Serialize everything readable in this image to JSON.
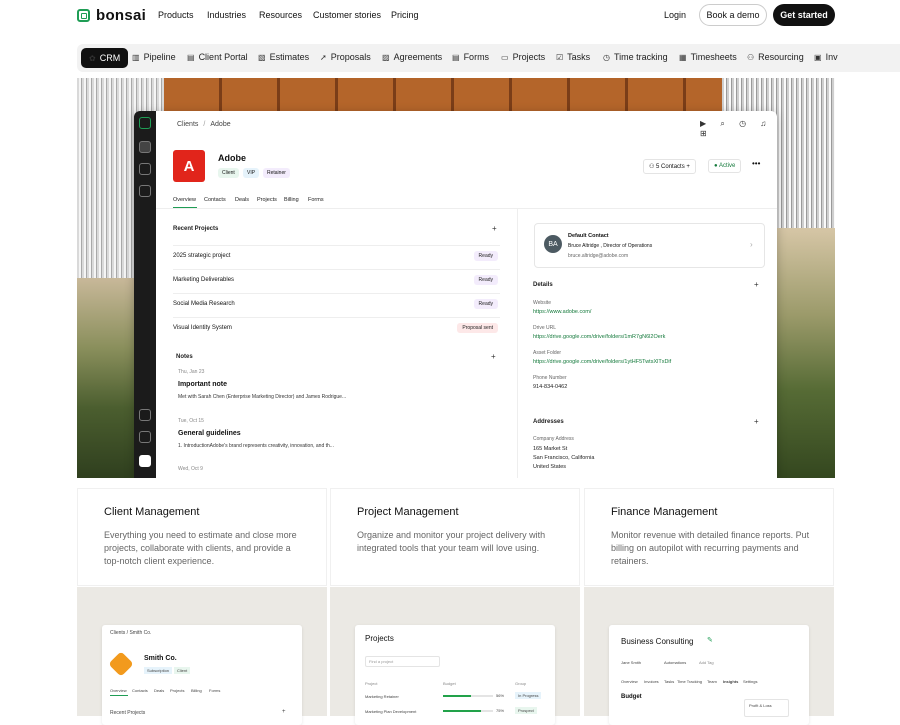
{
  "brand": {
    "name": "bonsai",
    "color": "#1f9d55"
  },
  "nav": {
    "links": [
      "Products",
      "Industries",
      "Resources",
      "Customer stories",
      "Pricing"
    ],
    "login": "Login",
    "demo": "Book a demo",
    "cta": "Get started"
  },
  "tabs": [
    {
      "label": "CRM",
      "icon": "crm-icon"
    },
    {
      "label": "Pipeline",
      "icon": "pipeline-icon"
    },
    {
      "label": "Client Portal",
      "icon": "portal-icon"
    },
    {
      "label": "Estimates",
      "icon": "estimates-icon"
    },
    {
      "label": "Proposals",
      "icon": "proposals-icon"
    },
    {
      "label": "Agreements",
      "icon": "agreements-icon"
    },
    {
      "label": "Forms",
      "icon": "forms-icon"
    },
    {
      "label": "Projects",
      "icon": "projects-icon"
    },
    {
      "label": "Tasks",
      "icon": "tasks-icon"
    },
    {
      "label": "Time tracking",
      "icon": "clock-icon"
    },
    {
      "label": "Timesheets",
      "icon": "timesheets-icon"
    },
    {
      "label": "Resourcing",
      "icon": "resourcing-icon"
    },
    {
      "label": "Inv",
      "icon": "invoice-icon"
    }
  ],
  "dashboard": {
    "breadcrumb": [
      "Clients",
      "/",
      "Adobe"
    ],
    "client": {
      "name": "Adobe",
      "logo_letter": "A",
      "tags": [
        "Client",
        "VIP",
        "Retainer"
      ]
    },
    "contacts": "5 Contacts",
    "status": "Active",
    "tabs": [
      "Overview",
      "Contacts",
      "Deals",
      "Projects",
      "Billing",
      "Forms"
    ],
    "recent_projects_title": "Recent Projects",
    "projects": [
      {
        "name": "2025 strategic project",
        "status": "Ready"
      },
      {
        "name": "Marketing Deliverables",
        "status": "Ready"
      },
      {
        "name": "Social Media Research",
        "status": "Ready"
      },
      {
        "name": "Visual Identity System",
        "status": "Proposal sent"
      }
    ],
    "notes_title": "Notes",
    "notes": [
      {
        "date": "Thu, Jan 23",
        "title": "Important note",
        "body": "Met with Sarah Chen (Enterprise Marketing Director) and James Rodrigue..."
      },
      {
        "date": "Tue, Oct 15",
        "title": "General guidelines",
        "body": "1. IntroductionAdobe's brand represents creativity, innovation, and th..."
      },
      {
        "date": "Wed, Oct 9",
        "title": "",
        "body": ""
      }
    ],
    "default_contact": {
      "label": "Default Contact",
      "initials": "BA",
      "name": "Bruce Altridge , Director of Operations",
      "email": "bruce.altridge@adobe.com"
    },
    "details_title": "Details",
    "details": [
      {
        "label": "Website",
        "value": "https://www.adobe.com/"
      },
      {
        "label": "Drive URL",
        "value": "https://drive.google.com/drive/folders/1mR7gN6l2Oerk"
      },
      {
        "label": "Asset Folder",
        "value": "https://drive.google.com/drive/folders/1ytHF5TwtsXlTxDif"
      },
      {
        "label": "Phone Number",
        "value": "914-834-0462"
      }
    ],
    "addresses_title": "Addresses",
    "address": {
      "label": "Company Address",
      "line1": "165 Market St",
      "line2": "San Francisco, California",
      "line3": "United States"
    }
  },
  "features": [
    {
      "title": "Client Management",
      "desc": "Everything you need to estimate and close more projects, collaborate with clients, and provide a top-notch client experience."
    },
    {
      "title": "Project Management",
      "desc": "Organize and monitor your project delivery with integrated tools that your team will love using."
    },
    {
      "title": "Finance Management",
      "desc": "Monitor revenue with detailed finance reports. Put billing on autopilot with recurring payments and retainers."
    }
  ],
  "previews": {
    "client": {
      "crumb": "Clients / Smith Co.",
      "name": "Smith Co.",
      "tags": [
        "Subscription",
        "Client"
      ],
      "tabs": [
        "Overview",
        "Contacts",
        "Deals",
        "Projects",
        "Billing",
        "Forms"
      ],
      "section": "Recent Projects"
    },
    "projects": {
      "title": "Projects",
      "search": "Find a project",
      "cols": [
        "Project",
        "Budget",
        "Group"
      ],
      "rows": [
        {
          "name": "Marketing Retainer",
          "pct": "56%",
          "fill": 0.56,
          "group": "In Progress"
        },
        {
          "name": "Marketing Plan Development",
          "pct": "75%",
          "fill": 0.75,
          "group": "Prospect"
        }
      ]
    },
    "finance": {
      "title": "Business Consulting",
      "owner": "Jane Smith",
      "automations": "Automations",
      "add": "Add Tag",
      "tabs": [
        "Overview",
        "Invoices",
        "Tasks",
        "Time Tracking",
        "Team",
        "Insights",
        "Settings"
      ],
      "section": "Budget",
      "card": "Profit & Loss"
    }
  }
}
